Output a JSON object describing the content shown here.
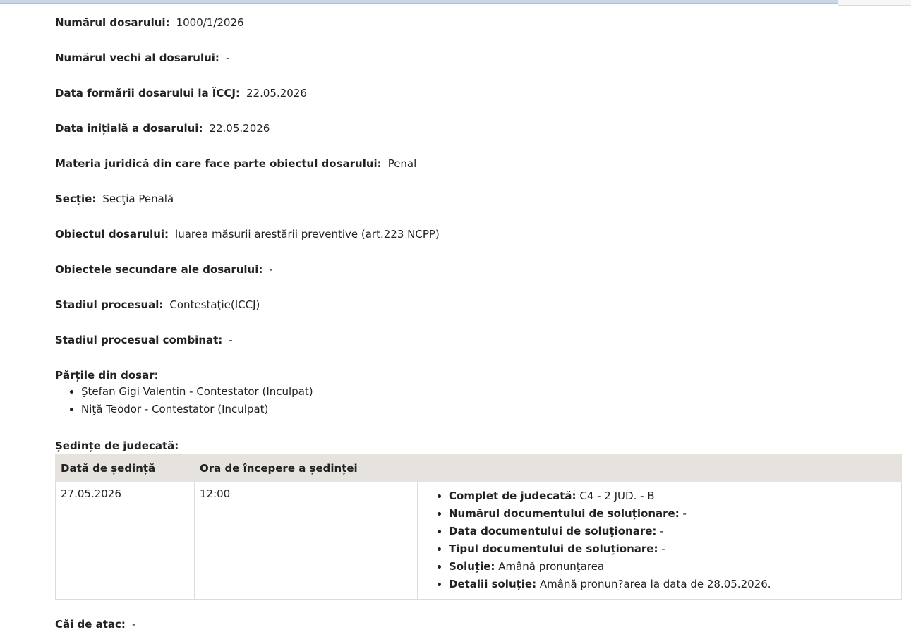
{
  "fields": [
    {
      "label": "Numărul dosarului:",
      "value": "1000/1/2026"
    },
    {
      "label": "Numărul vechi al dosarului:",
      "value": "-"
    },
    {
      "label": "Data formării dosarului la ÎCCJ:",
      "value": "22.05.2026"
    },
    {
      "label": "Data inițială a dosarului:",
      "value": "22.05.2026"
    },
    {
      "label": "Materia juridică din care face parte obiectul dosarului:",
      "value": "Penal"
    },
    {
      "label": "Secție:",
      "value": "Secţia Penală"
    },
    {
      "label": "Obiectul dosarului:",
      "value": "luarea măsurii arestării preventive (art.223 NCPP)"
    },
    {
      "label": "Obiectele secundare ale dosarului:",
      "value": "-"
    },
    {
      "label": "Stadiul procesual:",
      "value": "Contestaţie(ICCJ)"
    },
    {
      "label": "Stadiul procesual combinat:",
      "value": "-"
    }
  ],
  "parties": {
    "title": "Părțile din dosar:",
    "items": [
      "Ştefan Gigi Valentin - Contestator (Inculpat)",
      "Niţă Teodor - Contestator (Inculpat)"
    ]
  },
  "hearings": {
    "title": "Ședințe de judecată:",
    "headers": [
      "Dată de ședință",
      "Ora de începere a ședinței",
      ""
    ],
    "rows": [
      {
        "date": "27.05.2026",
        "time": "12:00",
        "details": [
          {
            "label": "Complet de judecată:",
            "value": "C4 - 2 JUD. - B"
          },
          {
            "label": "Numărul documentului de soluționare:",
            "value": "-"
          },
          {
            "label": "Data documentului de soluționare:",
            "value": "-"
          },
          {
            "label": "Tipul documentului de soluționare:",
            "value": "-"
          },
          {
            "label": "Soluție:",
            "value": "Amână pronunţarea"
          },
          {
            "label": "Detalii soluție:",
            "value": "Amână pronun?area la data de 28.05.2026."
          }
        ]
      }
    ]
  },
  "appeals": {
    "label": "Căi de atac:",
    "value": "-"
  }
}
